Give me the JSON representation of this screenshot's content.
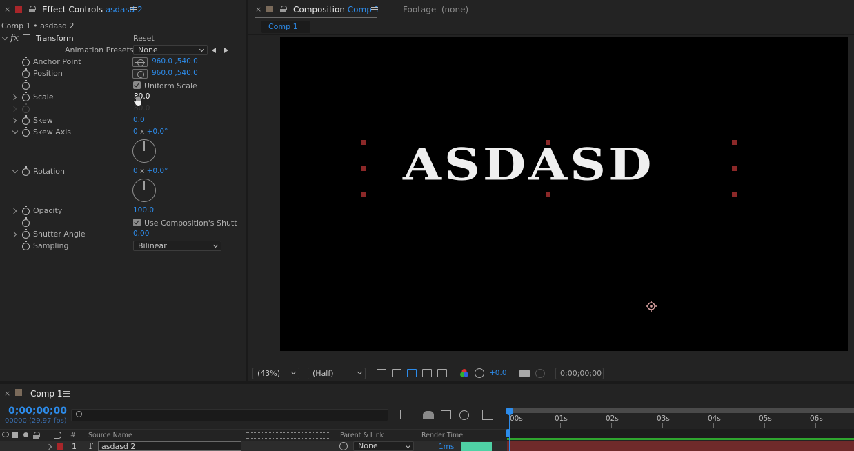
{
  "colors": {
    "accent": "#2d8ceb",
    "label_red": "#a8262a",
    "handle": "#8b2828",
    "render_bar": "#4fd1a5",
    "layer_bar": "#6f2a2a",
    "workarea_green": "#2fa52f"
  },
  "effect_controls": {
    "tab_prefix": "Effect Controls",
    "tab_layer": "asdasd 2",
    "breadcrumb": "Comp 1 • asdasd 2",
    "effect": {
      "fx": "fx",
      "name": "Transform",
      "reset": "Reset",
      "presets_label": "Animation Presets:",
      "presets_value": "None"
    },
    "props": {
      "anchor_point": {
        "label": "Anchor Point",
        "value": "960.0 ,540.0"
      },
      "position": {
        "label": "Position",
        "value": "960.0 ,540.0"
      },
      "uniform_scale": {
        "label": "Uniform Scale"
      },
      "scale": {
        "label": "Scale",
        "value": "80.0",
        "ghost_value": "80.0"
      },
      "skew": {
        "label": "Skew",
        "value": "0.0"
      },
      "skew_axis": {
        "label": "Skew Axis",
        "value_a": "0",
        "value_x": "x",
        "value_b": "+0.0",
        "unit": "°"
      },
      "rotation": {
        "label": "Rotation",
        "value_a": "0",
        "value_x": "x",
        "value_b": "+0.0",
        "unit": "°"
      },
      "opacity": {
        "label": "Opacity",
        "value": "100.0"
      },
      "use_comp_shutter": {
        "label": "Use Composition's Shutt"
      },
      "shutter_angle": {
        "label": "Shutter Angle",
        "value": "0.00"
      },
      "sampling": {
        "label": "Sampling",
        "value": "Bilinear"
      }
    }
  },
  "composition": {
    "tab_prefix": "Composition",
    "tab_comp": "Comp 1",
    "footage_tab": "Footage  (none)",
    "subtab": "Comp 1",
    "canvas_text": "ASDASD",
    "zoom": "(43%)",
    "resolution": "(Half)",
    "exposure": "+0.0",
    "timecode": "0;00;00;00"
  },
  "timeline": {
    "tab": "Comp 1",
    "timecode": "0;00;00;00",
    "frames": "00000 (29.97 fps)",
    "search_placeholder": "",
    "ruler": [
      "00s",
      "01s",
      "02s",
      "03s",
      "04s",
      "05s",
      "06s"
    ],
    "columns": {
      "num": "#",
      "source_name": "Source Name",
      "parent_link": "Parent & Link",
      "render_time": "Render Time"
    },
    "layer": {
      "index": "1",
      "type_glyph": "T",
      "name": "asdasd 2",
      "parent": "None",
      "render_time": "1ms"
    }
  }
}
